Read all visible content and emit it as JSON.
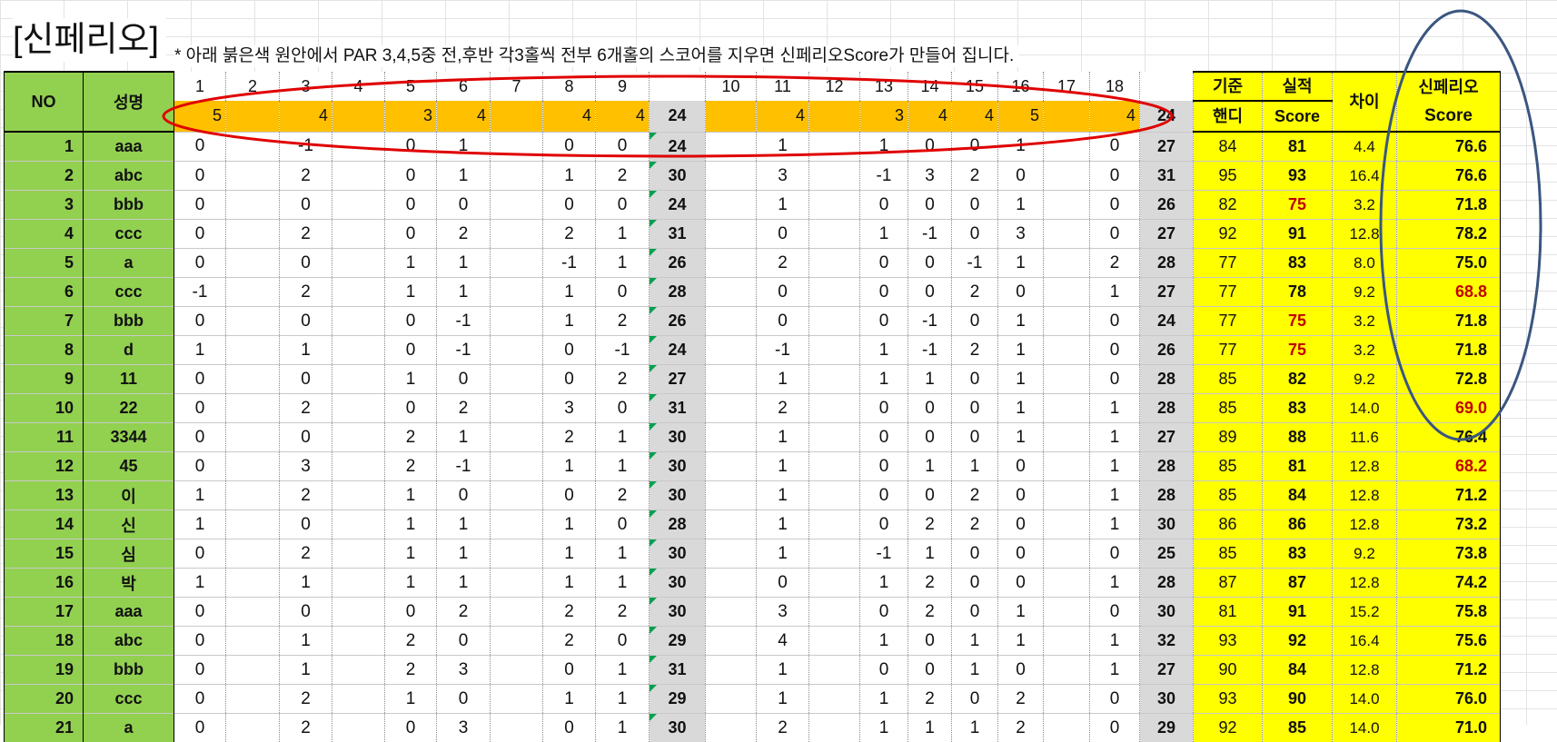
{
  "title": "[신페리오]",
  "subtitle": "* 아래 붉은색 원안에서 PAR 3,4,5중 전,후반 각3홀씩 전부 6개홀의 스코어를 지우면 신페리오Score가 만들어 집니다.",
  "headers": {
    "no": "NO",
    "name": "성명",
    "handicap_top": "기준",
    "handicap_bottom": "핸디",
    "actual_top": "실적",
    "actual_bottom": "Score",
    "diff": "차이",
    "sinperio_top": "신페리오",
    "sinperio_bottom": "Score"
  },
  "holes_front": [
    "1",
    "2",
    "3",
    "4",
    "5",
    "6",
    "7",
    "8",
    "9"
  ],
  "holes_back": [
    "10",
    "11",
    "12",
    "13",
    "14",
    "15",
    "16",
    "17",
    "18"
  ],
  "pars_front": [
    "5",
    "",
    "4",
    "",
    "3",
    "4",
    "",
    "4",
    "4"
  ],
  "par_front_total": "24",
  "pars_back": [
    "",
    "4",
    "",
    "3",
    "4",
    "4",
    "5",
    "",
    "4"
  ],
  "par_back_total": "24",
  "colors": {
    "green": "#92d050",
    "yellow": "#ffff00",
    "orange": "#ffc000",
    "gray": "#d9d9d9",
    "red_text": "#c00000",
    "red_circle": "#e00000",
    "blue_circle": "#3a5680"
  },
  "rows": [
    {
      "no": "1",
      "name": "aaa",
      "front": [
        "0",
        "",
        "-1",
        "",
        "0",
        "1",
        "",
        "0",
        "0"
      ],
      "front_total": "24",
      "back": [
        "",
        "1",
        "",
        "1",
        "0",
        "0",
        "1",
        "",
        "0"
      ],
      "back_total": "27",
      "handicap": "84",
      "actual": "81",
      "diff": "4.4",
      "sinperio": "76.6"
    },
    {
      "no": "2",
      "name": "abc",
      "front": [
        "0",
        "",
        "2",
        "",
        "0",
        "1",
        "",
        "1",
        "2"
      ],
      "front_total": "30",
      "back": [
        "",
        "3",
        "",
        "-1",
        "3",
        "2",
        "0",
        "",
        "0"
      ],
      "back_total": "31",
      "handicap": "95",
      "actual": "93",
      "diff": "16.4",
      "sinperio": "76.6"
    },
    {
      "no": "3",
      "name": "bbb",
      "front": [
        "0",
        "",
        "0",
        "",
        "0",
        "0",
        "",
        "0",
        "0"
      ],
      "front_total": "24",
      "back": [
        "",
        "1",
        "",
        "0",
        "0",
        "0",
        "1",
        "",
        "0"
      ],
      "back_total": "26",
      "handicap": "82",
      "actual": "75",
      "diff": "3.2",
      "sinperio": "71.8"
    },
    {
      "no": "4",
      "name": "ccc",
      "front": [
        "0",
        "",
        "2",
        "",
        "0",
        "2",
        "",
        "2",
        "1"
      ],
      "front_total": "31",
      "back": [
        "",
        "0",
        "",
        "1",
        "-1",
        "0",
        "3",
        "",
        "0"
      ],
      "back_total": "27",
      "handicap": "92",
      "actual": "91",
      "diff": "12.8",
      "sinperio": "78.2"
    },
    {
      "no": "5",
      "name": "a",
      "front": [
        "0",
        "",
        "0",
        "",
        "1",
        "1",
        "",
        "-1",
        "1"
      ],
      "front_total": "26",
      "back": [
        "",
        "2",
        "",
        "0",
        "0",
        "-1",
        "1",
        "",
        "2"
      ],
      "back_total": "28",
      "handicap": "77",
      "actual": "83",
      "diff": "8.0",
      "sinperio": "75.0"
    },
    {
      "no": "6",
      "name": "ccc",
      "front": [
        "-1",
        "",
        "2",
        "",
        "1",
        "1",
        "",
        "1",
        "0"
      ],
      "front_total": "28",
      "back": [
        "",
        "0",
        "",
        "0",
        "0",
        "2",
        "0",
        "",
        "1"
      ],
      "back_total": "27",
      "handicap": "77",
      "actual": "78",
      "diff": "9.2",
      "sinperio": "68.8"
    },
    {
      "no": "7",
      "name": "bbb",
      "front": [
        "0",
        "",
        "0",
        "",
        "0",
        "-1",
        "",
        "1",
        "2"
      ],
      "front_total": "26",
      "back": [
        "",
        "0",
        "",
        "0",
        "-1",
        "0",
        "1",
        "",
        "0"
      ],
      "back_total": "24",
      "handicap": "77",
      "actual": "75",
      "diff": "3.2",
      "sinperio": "71.8"
    },
    {
      "no": "8",
      "name": "d",
      "front": [
        "1",
        "",
        "1",
        "",
        "0",
        "-1",
        "",
        "0",
        "-1"
      ],
      "front_total": "24",
      "back": [
        "",
        "-1",
        "",
        "1",
        "-1",
        "2",
        "1",
        "",
        "0"
      ],
      "back_total": "26",
      "handicap": "77",
      "actual": "75",
      "diff": "3.2",
      "sinperio": "71.8"
    },
    {
      "no": "9",
      "name": "11",
      "front": [
        "0",
        "",
        "0",
        "",
        "1",
        "0",
        "",
        "0",
        "2"
      ],
      "front_total": "27",
      "back": [
        "",
        "1",
        "",
        "1",
        "1",
        "0",
        "1",
        "",
        "0"
      ],
      "back_total": "28",
      "handicap": "85",
      "actual": "82",
      "diff": "9.2",
      "sinperio": "72.8"
    },
    {
      "no": "10",
      "name": "22",
      "front": [
        "0",
        "",
        "2",
        "",
        "0",
        "2",
        "",
        "3",
        "0"
      ],
      "front_total": "31",
      "back": [
        "",
        "2",
        "",
        "0",
        "0",
        "0",
        "1",
        "",
        "1"
      ],
      "back_total": "28",
      "handicap": "85",
      "actual": "83",
      "diff": "14.0",
      "sinperio": "69.0"
    },
    {
      "no": "11",
      "name": "3344",
      "front": [
        "0",
        "",
        "0",
        "",
        "2",
        "1",
        "",
        "2",
        "1"
      ],
      "front_total": "30",
      "back": [
        "",
        "1",
        "",
        "0",
        "0",
        "0",
        "1",
        "",
        "1"
      ],
      "back_total": "27",
      "handicap": "89",
      "actual": "88",
      "diff": "11.6",
      "sinperio": "76.4"
    },
    {
      "no": "12",
      "name": "45",
      "front": [
        "0",
        "",
        "3",
        "",
        "2",
        "-1",
        "",
        "1",
        "1"
      ],
      "front_total": "30",
      "back": [
        "",
        "1",
        "",
        "0",
        "1",
        "1",
        "0",
        "",
        "1"
      ],
      "back_total": "28",
      "handicap": "85",
      "actual": "81",
      "diff": "12.8",
      "sinperio": "68.2"
    },
    {
      "no": "13",
      "name": "이",
      "front": [
        "1",
        "",
        "2",
        "",
        "1",
        "0",
        "",
        "0",
        "2"
      ],
      "front_total": "30",
      "back": [
        "",
        "1",
        "",
        "0",
        "0",
        "2",
        "0",
        "",
        "1"
      ],
      "back_total": "28",
      "handicap": "85",
      "actual": "84",
      "diff": "12.8",
      "sinperio": "71.2"
    },
    {
      "no": "14",
      "name": "신",
      "front": [
        "1",
        "",
        "0",
        "",
        "1",
        "1",
        "",
        "1",
        "0"
      ],
      "front_total": "28",
      "back": [
        "",
        "1",
        "",
        "0",
        "2",
        "2",
        "0",
        "",
        "1"
      ],
      "back_total": "30",
      "handicap": "86",
      "actual": "86",
      "diff": "12.8",
      "sinperio": "73.2"
    },
    {
      "no": "15",
      "name": "심",
      "front": [
        "0",
        "",
        "2",
        "",
        "1",
        "1",
        "",
        "1",
        "1"
      ],
      "front_total": "30",
      "back": [
        "",
        "1",
        "",
        "-1",
        "1",
        "0",
        "0",
        "",
        "0"
      ],
      "back_total": "25",
      "handicap": "85",
      "actual": "83",
      "diff": "9.2",
      "sinperio": "73.8"
    },
    {
      "no": "16",
      "name": "박",
      "front": [
        "1",
        "",
        "1",
        "",
        "1",
        "1",
        "",
        "1",
        "1"
      ],
      "front_total": "30",
      "back": [
        "",
        "0",
        "",
        "1",
        "2",
        "0",
        "0",
        "",
        "1"
      ],
      "back_total": "28",
      "handicap": "87",
      "actual": "87",
      "diff": "12.8",
      "sinperio": "74.2"
    },
    {
      "no": "17",
      "name": "aaa",
      "front": [
        "0",
        "",
        "0",
        "",
        "0",
        "2",
        "",
        "2",
        "2"
      ],
      "front_total": "30",
      "back": [
        "",
        "3",
        "",
        "0",
        "2",
        "0",
        "1",
        "",
        "0"
      ],
      "back_total": "30",
      "handicap": "81",
      "actual": "91",
      "diff": "15.2",
      "sinperio": "75.8"
    },
    {
      "no": "18",
      "name": "abc",
      "front": [
        "0",
        "",
        "1",
        "",
        "2",
        "0",
        "",
        "2",
        "0"
      ],
      "front_total": "29",
      "back": [
        "",
        "4",
        "",
        "1",
        "0",
        "1",
        "1",
        "",
        "1"
      ],
      "back_total": "32",
      "handicap": "93",
      "actual": "92",
      "diff": "16.4",
      "sinperio": "75.6"
    },
    {
      "no": "19",
      "name": "bbb",
      "front": [
        "0",
        "",
        "1",
        "",
        "2",
        "3",
        "",
        "0",
        "1"
      ],
      "front_total": "31",
      "back": [
        "",
        "1",
        "",
        "0",
        "0",
        "1",
        "0",
        "",
        "1"
      ],
      "back_total": "27",
      "handicap": "90",
      "actual": "84",
      "diff": "12.8",
      "sinperio": "71.2"
    },
    {
      "no": "20",
      "name": "ccc",
      "front": [
        "0",
        "",
        "2",
        "",
        "1",
        "0",
        "",
        "1",
        "1"
      ],
      "front_total": "29",
      "back": [
        "",
        "1",
        "",
        "1",
        "2",
        "0",
        "2",
        "",
        "0"
      ],
      "back_total": "30",
      "handicap": "93",
      "actual": "90",
      "diff": "14.0",
      "sinperio": "76.0"
    },
    {
      "no": "21",
      "name": "a",
      "front": [
        "0",
        "",
        "2",
        "",
        "0",
        "3",
        "",
        "0",
        "1"
      ],
      "front_total": "30",
      "back": [
        "",
        "2",
        "",
        "1",
        "1",
        "1",
        "2",
        "",
        "0"
      ],
      "back_total": "29",
      "handicap": "92",
      "actual": "85",
      "diff": "14.0",
      "sinperio": "71.0"
    }
  ]
}
